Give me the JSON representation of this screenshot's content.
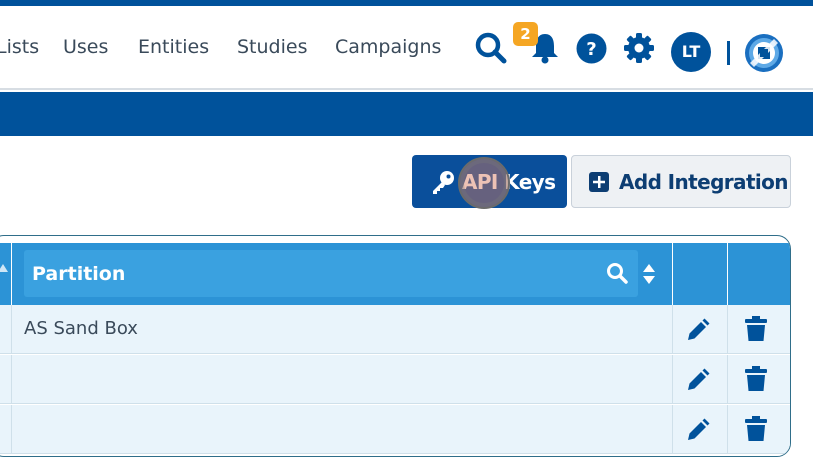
{
  "nav": {
    "links": [
      "Lists",
      "Uses",
      "Entities",
      "Studies",
      "Campaigns"
    ],
    "icons": [
      "search-icon",
      "bell-icon",
      "help-icon",
      "gear-icon"
    ],
    "notification_count": "2",
    "user_initials": "LT"
  },
  "toolbar": {
    "api_keys_label": "API Keys",
    "add_integration_label": "Add Integration"
  },
  "table": {
    "headers": {
      "partition": "Partition"
    },
    "rows": [
      {
        "partition": "AS Sand Box"
      },
      {
        "partition": ""
      },
      {
        "partition": ""
      }
    ]
  },
  "colors": {
    "primary": "#00529b",
    "header_blue": "#2c93d6",
    "row_bg": "#e9f4fb",
    "badge": "#f5a623"
  }
}
